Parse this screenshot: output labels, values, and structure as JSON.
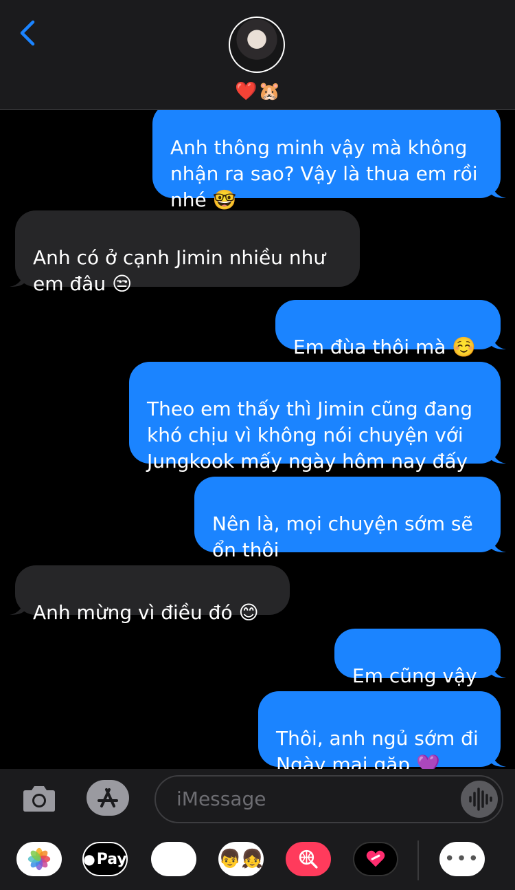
{
  "header": {
    "emojis": [
      "❤️",
      "🐹"
    ]
  },
  "messages": [
    {
      "dir": "out",
      "text": "Anh thông minh vậy mà không\nnhận ra sao? Vậy là thua em rồi\nnhé 🤓"
    },
    {
      "dir": "in",
      "text": "Anh có ở cạnh Jimin nhiều như\nem đâu 😒"
    },
    {
      "dir": "out",
      "text": "Em đùa thôi mà ☺️"
    },
    {
      "dir": "out",
      "text": "Theo em thấy thì Jimin cũng đang\nkhó chịu vì không nói chuyện với\nJungkook mấy ngày hôm nay đấy"
    },
    {
      "dir": "out",
      "text": "Nên là, mọi chuyện sớm sẽ\nổn thôi"
    },
    {
      "dir": "in",
      "text": "Anh mừng vì điều đó 😊"
    },
    {
      "dir": "out",
      "text": "Em cũng vậy"
    },
    {
      "dir": "out",
      "text": "Thôi, anh ngủ sớm đi\nNgày mai gặp 💜"
    }
  ],
  "composer": {
    "placeholder": "iMessage"
  },
  "apps": {
    "photos": "photos-icon",
    "applepay_label": "Pay",
    "memoji": "🐵",
    "animoji": "🧑‍🤝‍🧑",
    "search": "search-icon",
    "fitness": "heart-icon",
    "more": "•••"
  },
  "colors": {
    "bubble_out": "#1b84ff",
    "bubble_in": "#262628",
    "accent": "#1b84ff"
  }
}
